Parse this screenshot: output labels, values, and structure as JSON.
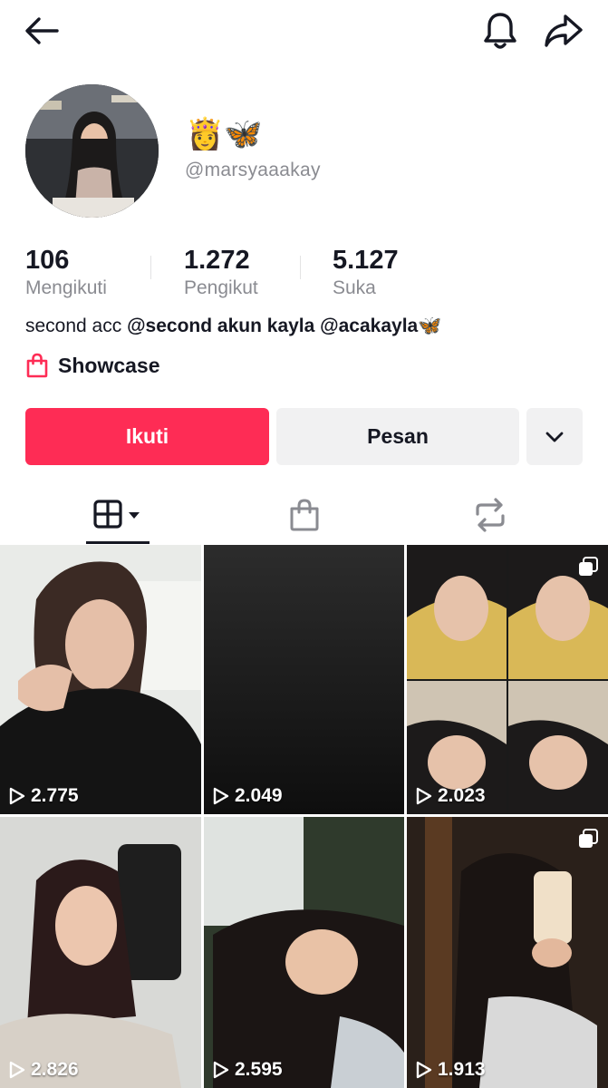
{
  "profile": {
    "display_name": "👸🦋",
    "username": "@marsyaaakay"
  },
  "stats": {
    "following": {
      "value": "106",
      "label": "Mengikuti"
    },
    "followers": {
      "value": "1.272",
      "label": "Pengikut"
    },
    "likes": {
      "value": "5.127",
      "label": "Suka"
    }
  },
  "bio": {
    "prefix": "second acc ",
    "mention_1": "@second akun kayla",
    "mention_2": " @acakayla",
    "suffix": "🦋"
  },
  "showcase_label": "Showcase",
  "actions": {
    "follow_label": "Ikuti",
    "message_label": "Pesan"
  },
  "colors": {
    "accent": "#fe2c55",
    "secondary_button": "#f1f1f2",
    "muted_text": "#8a8b91"
  },
  "icons": {
    "back": "arrow-left-icon",
    "notifications": "bell-icon",
    "share": "share-arrow-icon",
    "showcase": "shopping-bag-icon",
    "more": "chevron-down-icon",
    "videos_tab": "grid-icon",
    "shop_tab": "shopping-bag-icon",
    "repost_tab": "repost-icon",
    "views": "play-icon",
    "multi_photo": "photo-stack-icon"
  },
  "videos": [
    {
      "views": "2.775",
      "multi": false
    },
    {
      "views": "2.049",
      "multi": false
    },
    {
      "views": "2.023",
      "multi": true
    },
    {
      "views": "2.826",
      "multi": false
    },
    {
      "views": "2.595",
      "multi": false
    },
    {
      "views": "1.913",
      "multi": true
    }
  ]
}
